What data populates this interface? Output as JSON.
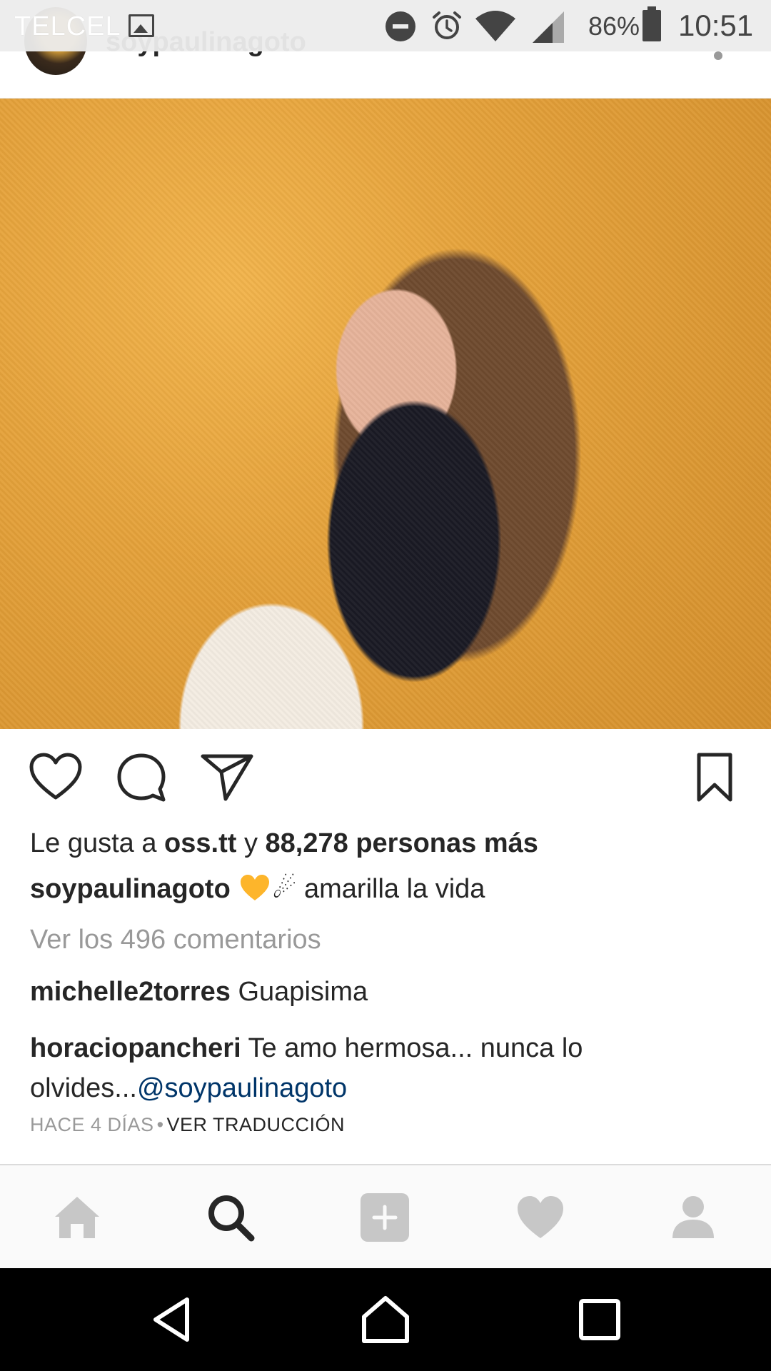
{
  "status_bar": {
    "carrier": "TELCEL",
    "battery_percent": "86%",
    "time": "10:51",
    "icons": [
      "image-icon",
      "do-not-disturb-icon",
      "alarm-icon",
      "wifi-icon",
      "signal-icon",
      "battery-icon"
    ]
  },
  "post": {
    "username": "soypaulinagoto",
    "likes": {
      "prefix": "Le gusta a ",
      "user": "oss.tt",
      "joiner": " y ",
      "count_text": "88,278 personas más"
    },
    "caption": {
      "user": "soypaulinagoto",
      "emoji_1": "yellow-heart",
      "emoji_2": "☄",
      "text": "amarilla la vida"
    },
    "view_comments": "Ver los 496 comentarios",
    "comments": [
      {
        "user": "michelle2torres",
        "text": "Guapisima"
      },
      {
        "user": "horaciopancheri",
        "text": "Te amo hermosa... nunca lo olvides...",
        "mention": "@soypaulinagoto"
      }
    ],
    "time_ago": "HACE 4 DÍAS",
    "separator": "•",
    "translate": "VER TRADUCCIÓN"
  },
  "colors": {
    "mention": "#003569",
    "muted": "#999999",
    "text": "#262626",
    "heart_emoji": "#FDB52B"
  },
  "tab_bar": [
    "home-icon",
    "search-icon",
    "add-post-icon",
    "activity-heart-icon",
    "profile-icon"
  ],
  "nav_bar": [
    "back-icon",
    "home-circle-icon",
    "recents-icon"
  ]
}
